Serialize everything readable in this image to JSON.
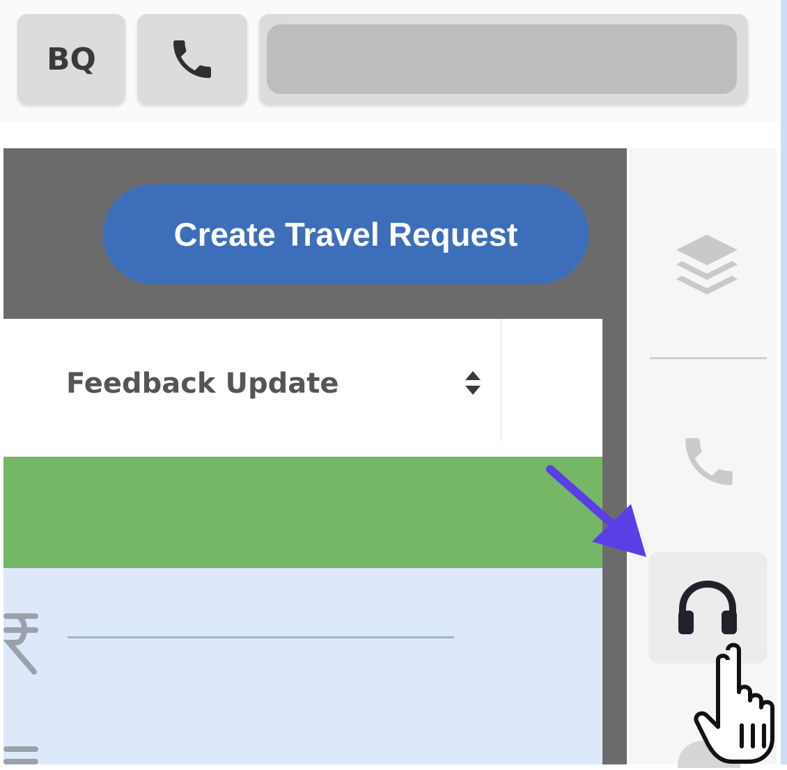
{
  "topbar": {
    "initials": "BQ",
    "phone_icon": "phone-icon",
    "search_placeholder": ""
  },
  "main": {
    "create_button_label": "Create Travel Request",
    "table": {
      "column_header": "Feedback Update",
      "sort_icon": "sort-icon"
    }
  },
  "sidebar": {
    "icons": [
      "layers-icon",
      "phone-icon",
      "headset-icon"
    ]
  },
  "colors": {
    "primary_button": "#3d6eb9",
    "row_highlight": "#75b667",
    "row_selected": "#dde8fa",
    "panel_dark": "#6b6b6b",
    "annotation_arrow": "#5b3ee6"
  }
}
